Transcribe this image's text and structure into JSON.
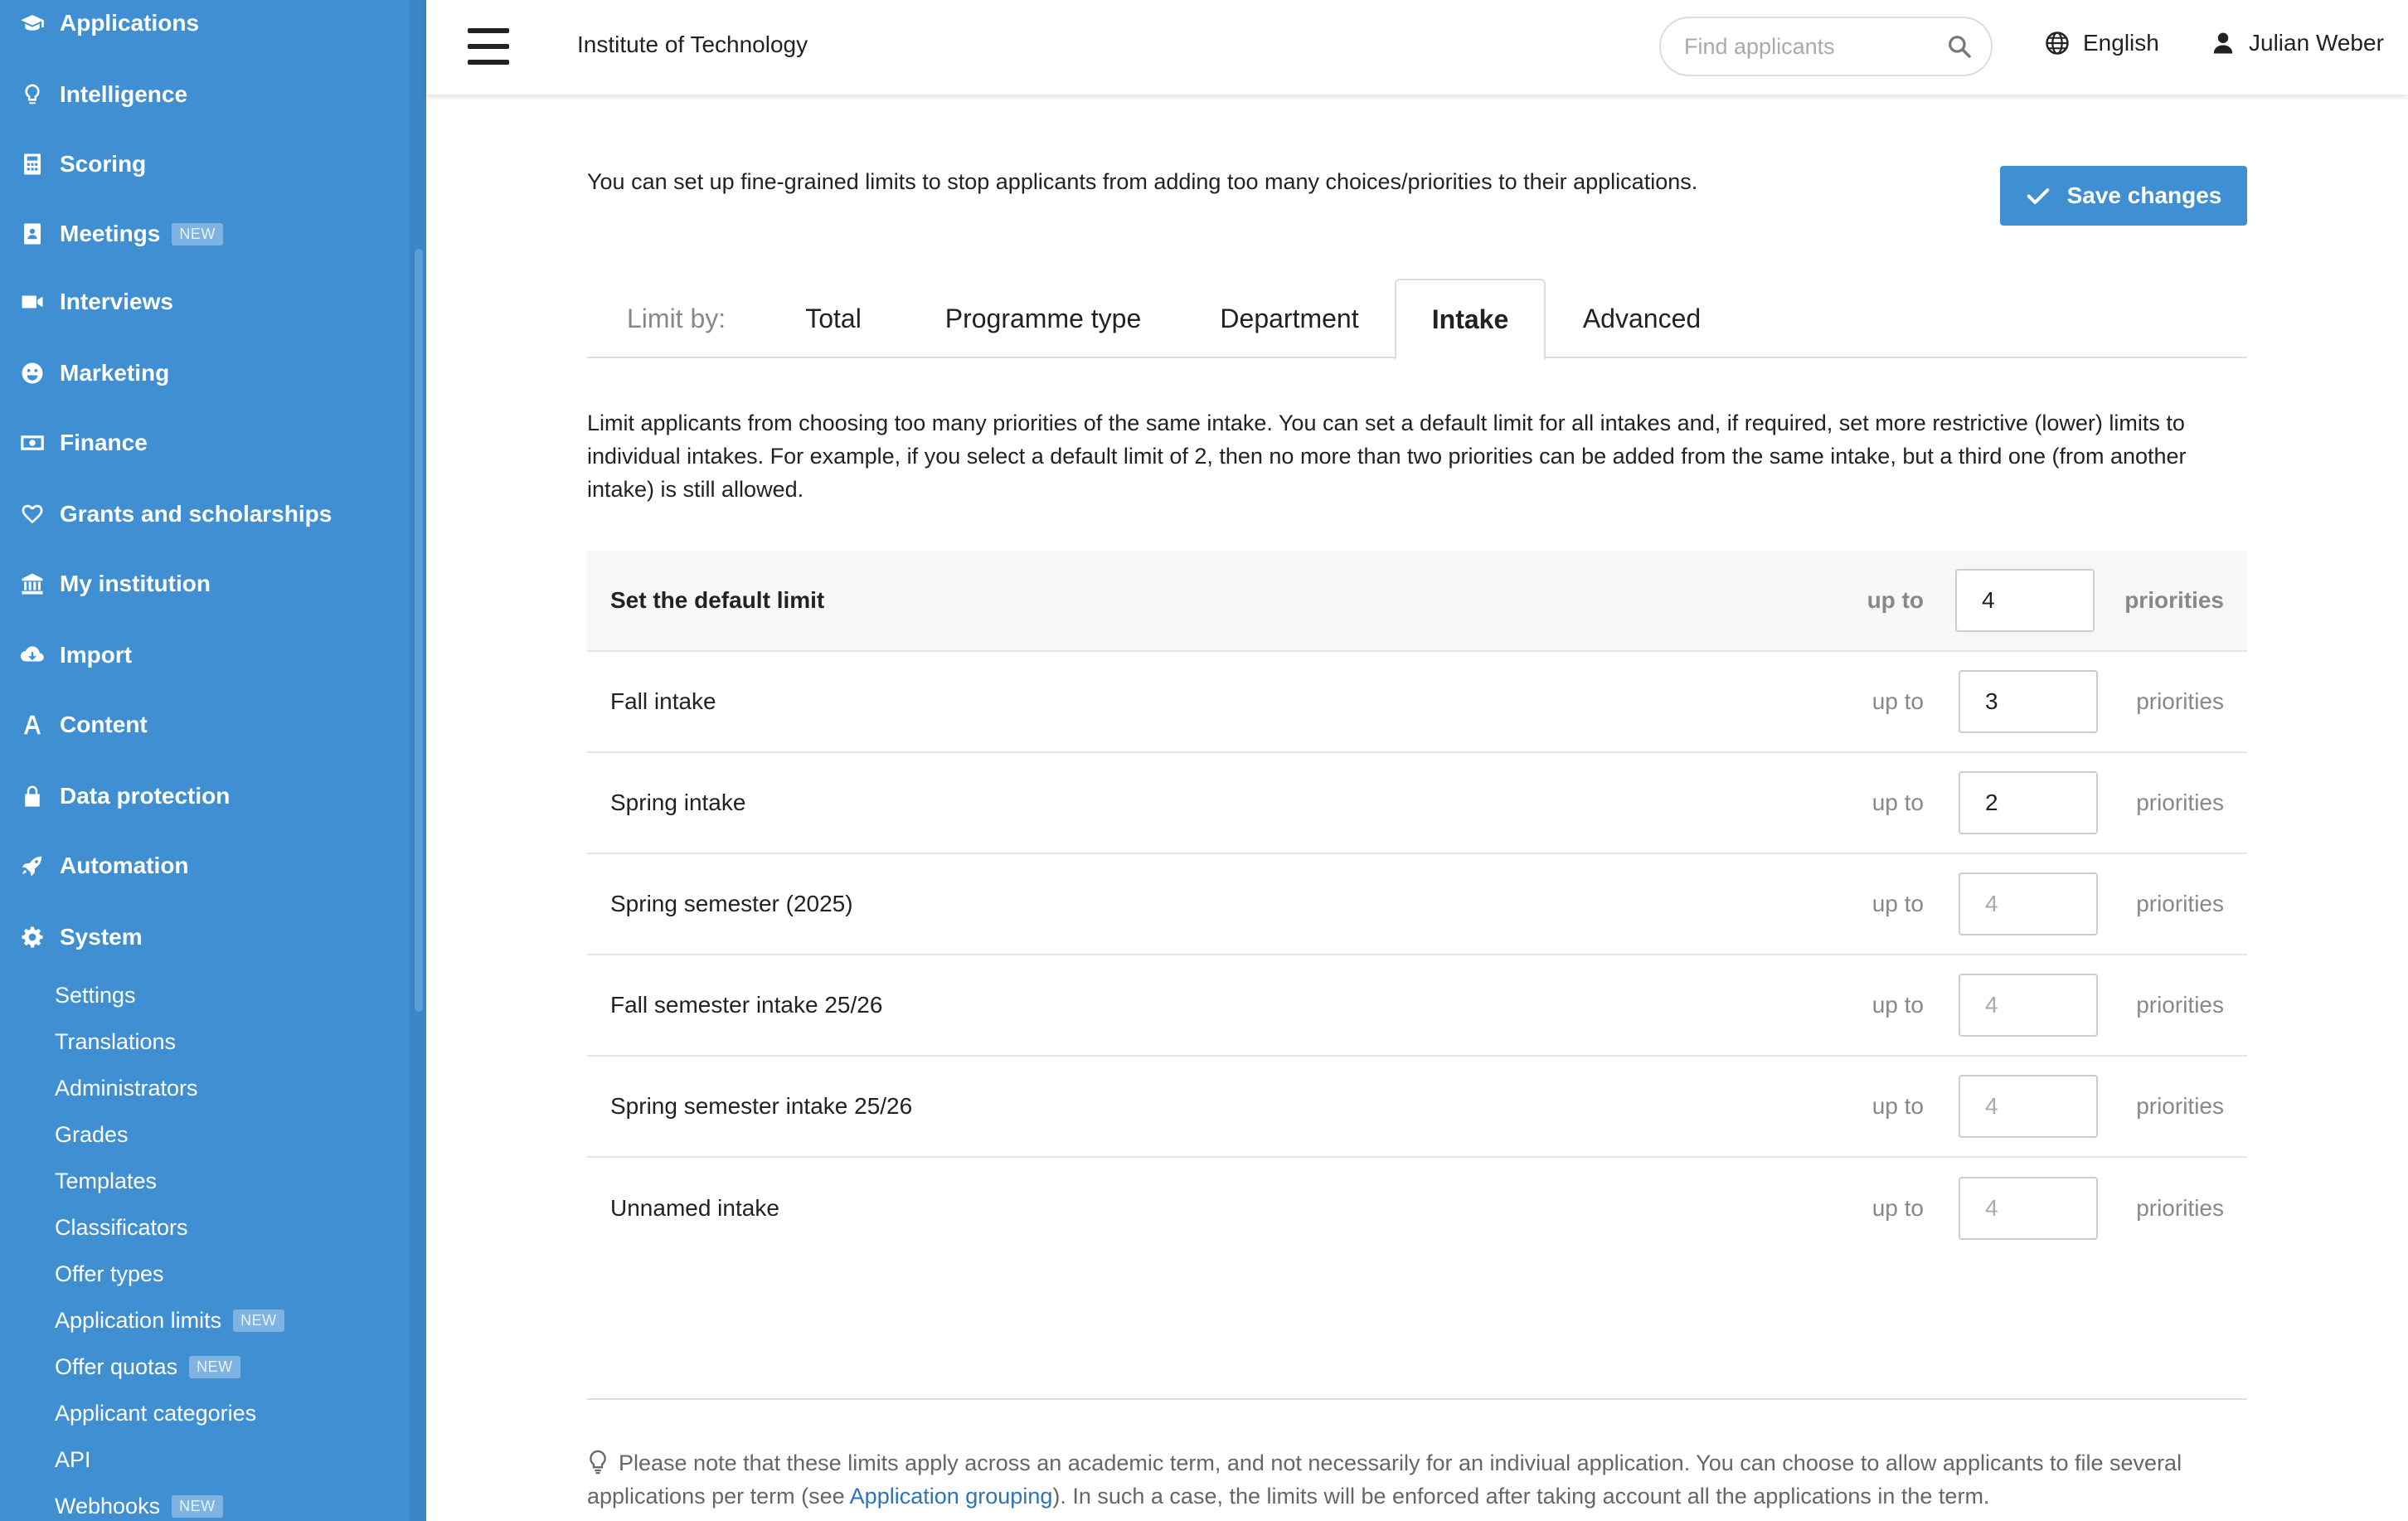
{
  "sidebar": {
    "items": [
      {
        "label": "Applications",
        "icon": "graduation-cap-icon",
        "badge": ""
      },
      {
        "label": "Intelligence",
        "icon": "lightbulb-icon",
        "badge": ""
      },
      {
        "label": "Scoring",
        "icon": "calculator-icon",
        "badge": ""
      },
      {
        "label": "Meetings",
        "icon": "contact-book-icon",
        "badge": "NEW"
      },
      {
        "label": "Interviews",
        "icon": "video-camera-icon",
        "badge": ""
      },
      {
        "label": "Marketing",
        "icon": "smiley-icon",
        "badge": ""
      },
      {
        "label": "Finance",
        "icon": "money-bill-icon",
        "badge": ""
      },
      {
        "label": "Grants and scholarships",
        "icon": "heart-icon",
        "badge": ""
      },
      {
        "label": "My institution",
        "icon": "institution-icon",
        "badge": ""
      },
      {
        "label": "Import",
        "icon": "cloud-download-icon",
        "badge": ""
      },
      {
        "label": "Content",
        "icon": "font-icon",
        "badge": ""
      },
      {
        "label": "Data protection",
        "icon": "lock-icon",
        "badge": ""
      },
      {
        "label": "Automation",
        "icon": "rocket-icon",
        "badge": ""
      },
      {
        "label": "System",
        "icon": "gear-icon",
        "badge": ""
      }
    ],
    "subitems": [
      {
        "label": "Settings",
        "badge": ""
      },
      {
        "label": "Translations",
        "badge": ""
      },
      {
        "label": "Administrators",
        "badge": ""
      },
      {
        "label": "Grades",
        "badge": ""
      },
      {
        "label": "Templates",
        "badge": ""
      },
      {
        "label": "Classificators",
        "badge": ""
      },
      {
        "label": "Offer types",
        "badge": ""
      },
      {
        "label": "Application limits",
        "badge": "NEW"
      },
      {
        "label": "Offer quotas",
        "badge": "NEW"
      },
      {
        "label": "Applicant categories",
        "badge": ""
      },
      {
        "label": "API",
        "badge": ""
      },
      {
        "label": "Webhooks",
        "badge": "NEW"
      }
    ]
  },
  "header": {
    "institution": "Institute of Technology",
    "search_placeholder": "Find applicants",
    "language": "English",
    "user": "Julian Weber"
  },
  "main": {
    "intro": "You can set up fine-grained limits to stop applicants from adding too many choices/priorities to their applications.",
    "save_label": "Save changes",
    "tabs": {
      "prefix": "Limit by:",
      "items": [
        "Total",
        "Programme type",
        "Department",
        "Intake",
        "Advanced"
      ],
      "active": "Intake"
    },
    "description": "Limit applicants from choosing too many priorities of the same intake. You can set a default limit for all intakes and, if required, set more restrictive (lower) limits to individual intakes. For example, if you select a default limit of 2, then no more than two priorities can be added from the same intake, but a third one (from another intake) is still allowed.",
    "up_to": "up to",
    "priorities": "priorities",
    "rows": [
      {
        "name": "Set the default limit",
        "value": "4",
        "placeholder": ""
      },
      {
        "name": "Fall intake",
        "value": "3",
        "placeholder": "4"
      },
      {
        "name": "Spring intake",
        "value": "2",
        "placeholder": "4"
      },
      {
        "name": "Spring semester (2025)",
        "value": "",
        "placeholder": "4"
      },
      {
        "name": "Fall semester intake 25/26",
        "value": "",
        "placeholder": "4"
      },
      {
        "name": "Spring semester intake 25/26",
        "value": "",
        "placeholder": "4"
      },
      {
        "name": "Unnamed intake",
        "value": "",
        "placeholder": "4"
      }
    ],
    "note_before": "Please note that these limits apply across an academic term, and not necessarily for an indiviual application. You can choose to allow applicants to file several applications per term (see ",
    "note_link": "Application grouping",
    "note_after": "). In such a case, the limits will be enforced after taking account all the applications in the term."
  },
  "colors": {
    "sidebar": "#3f8fd2",
    "accent": "#3f8fd2",
    "link": "#2d73b6"
  }
}
